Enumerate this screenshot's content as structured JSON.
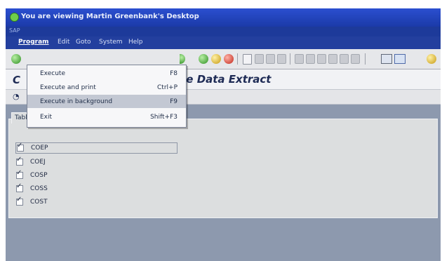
{
  "window": {
    "title": "You are viewing Martin Greenbank's Desktop"
  },
  "system": {
    "label": "SAP"
  },
  "menubar": {
    "items": [
      {
        "label": "Program",
        "active": true
      },
      {
        "label": "Edit",
        "active": false
      },
      {
        "label": "Goto",
        "active": false
      },
      {
        "label": "System",
        "active": false
      },
      {
        "label": "Help",
        "active": false
      }
    ]
  },
  "page": {
    "title_left": "C",
    "title_right": "ate Data Extract",
    "app_toolbar_icon": "execute-clock-icon"
  },
  "dropdown": {
    "items": [
      {
        "label": "Execute",
        "shortcut": "F8",
        "highlighted": false
      },
      {
        "label": "Execute and print",
        "shortcut": "Ctrl+P",
        "highlighted": false
      },
      {
        "label": "Execute in background",
        "shortcut": "F9",
        "highlighted": true
      },
      {
        "label": "Exit",
        "shortcut": "Shift+F3",
        "highlighted": false
      }
    ]
  },
  "group": {
    "title": "Tables to be analysed",
    "items": [
      {
        "label": "COEP",
        "checked": true
      },
      {
        "label": "COEJ",
        "checked": true
      },
      {
        "label": "COSP",
        "checked": true
      },
      {
        "label": "COSS",
        "checked": true
      },
      {
        "label": "COST",
        "checked": true
      }
    ]
  },
  "colors": {
    "title_bar": "#2b4fd0",
    "menu_bar": "#233f9e",
    "background": "#8d99ae",
    "panel": "#dcdedf",
    "highlight": "#c3c8d3"
  }
}
